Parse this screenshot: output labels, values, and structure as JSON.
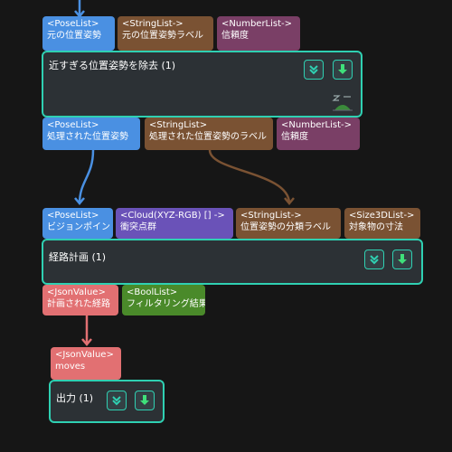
{
  "colors": {
    "teal_border": "#2fd0b2",
    "pose_port": "#4a90e2",
    "string_port": "#7a5233",
    "number_port": "#7a3f66",
    "cloud_port": "#6a52b8",
    "json_port": "#e27072",
    "bool_port": "#4a8a2a"
  },
  "node1": {
    "title": "近すぎる位置姿勢を除去 (1)",
    "inputs": [
      {
        "type": "<PoseList>",
        "name": "元の位置姿勢",
        "icon": "pose-port"
      },
      {
        "type": "<StringList->",
        "name": "元の位置姿勢ラベル",
        "icon": "string-port"
      },
      {
        "type": "<NumberList->",
        "name": "信頼度",
        "icon": "number-port"
      }
    ],
    "outputs": [
      {
        "type": "<PoseList>",
        "name": "処理された位置姿勢"
      },
      {
        "type": "<StringList>",
        "name": "処理された位置姿勢のラベル"
      },
      {
        "type": "<NumberList->",
        "name": "信頼度"
      }
    ]
  },
  "node2": {
    "title": "経路計画 (1)",
    "inputs": [
      {
        "type": "<PoseList>",
        "name": "ビジョンポイント"
      },
      {
        "type": "<Cloud(XYZ-RGB) [] ->",
        "name": "衝突点群"
      },
      {
        "type": "<StringList->",
        "name": "位置姿勢の分類ラベル"
      },
      {
        "type": "<Size3DList->",
        "name": "対象物の寸法"
      }
    ],
    "outputs": [
      {
        "type": "<JsonValue>",
        "name": "計画された経路"
      },
      {
        "type": "<BoolList>",
        "name": "フィルタリング結果"
      }
    ]
  },
  "node3": {
    "title": "出力 (1)",
    "inputs": [
      {
        "type": "<JsonValue>",
        "name": "moves"
      }
    ]
  }
}
